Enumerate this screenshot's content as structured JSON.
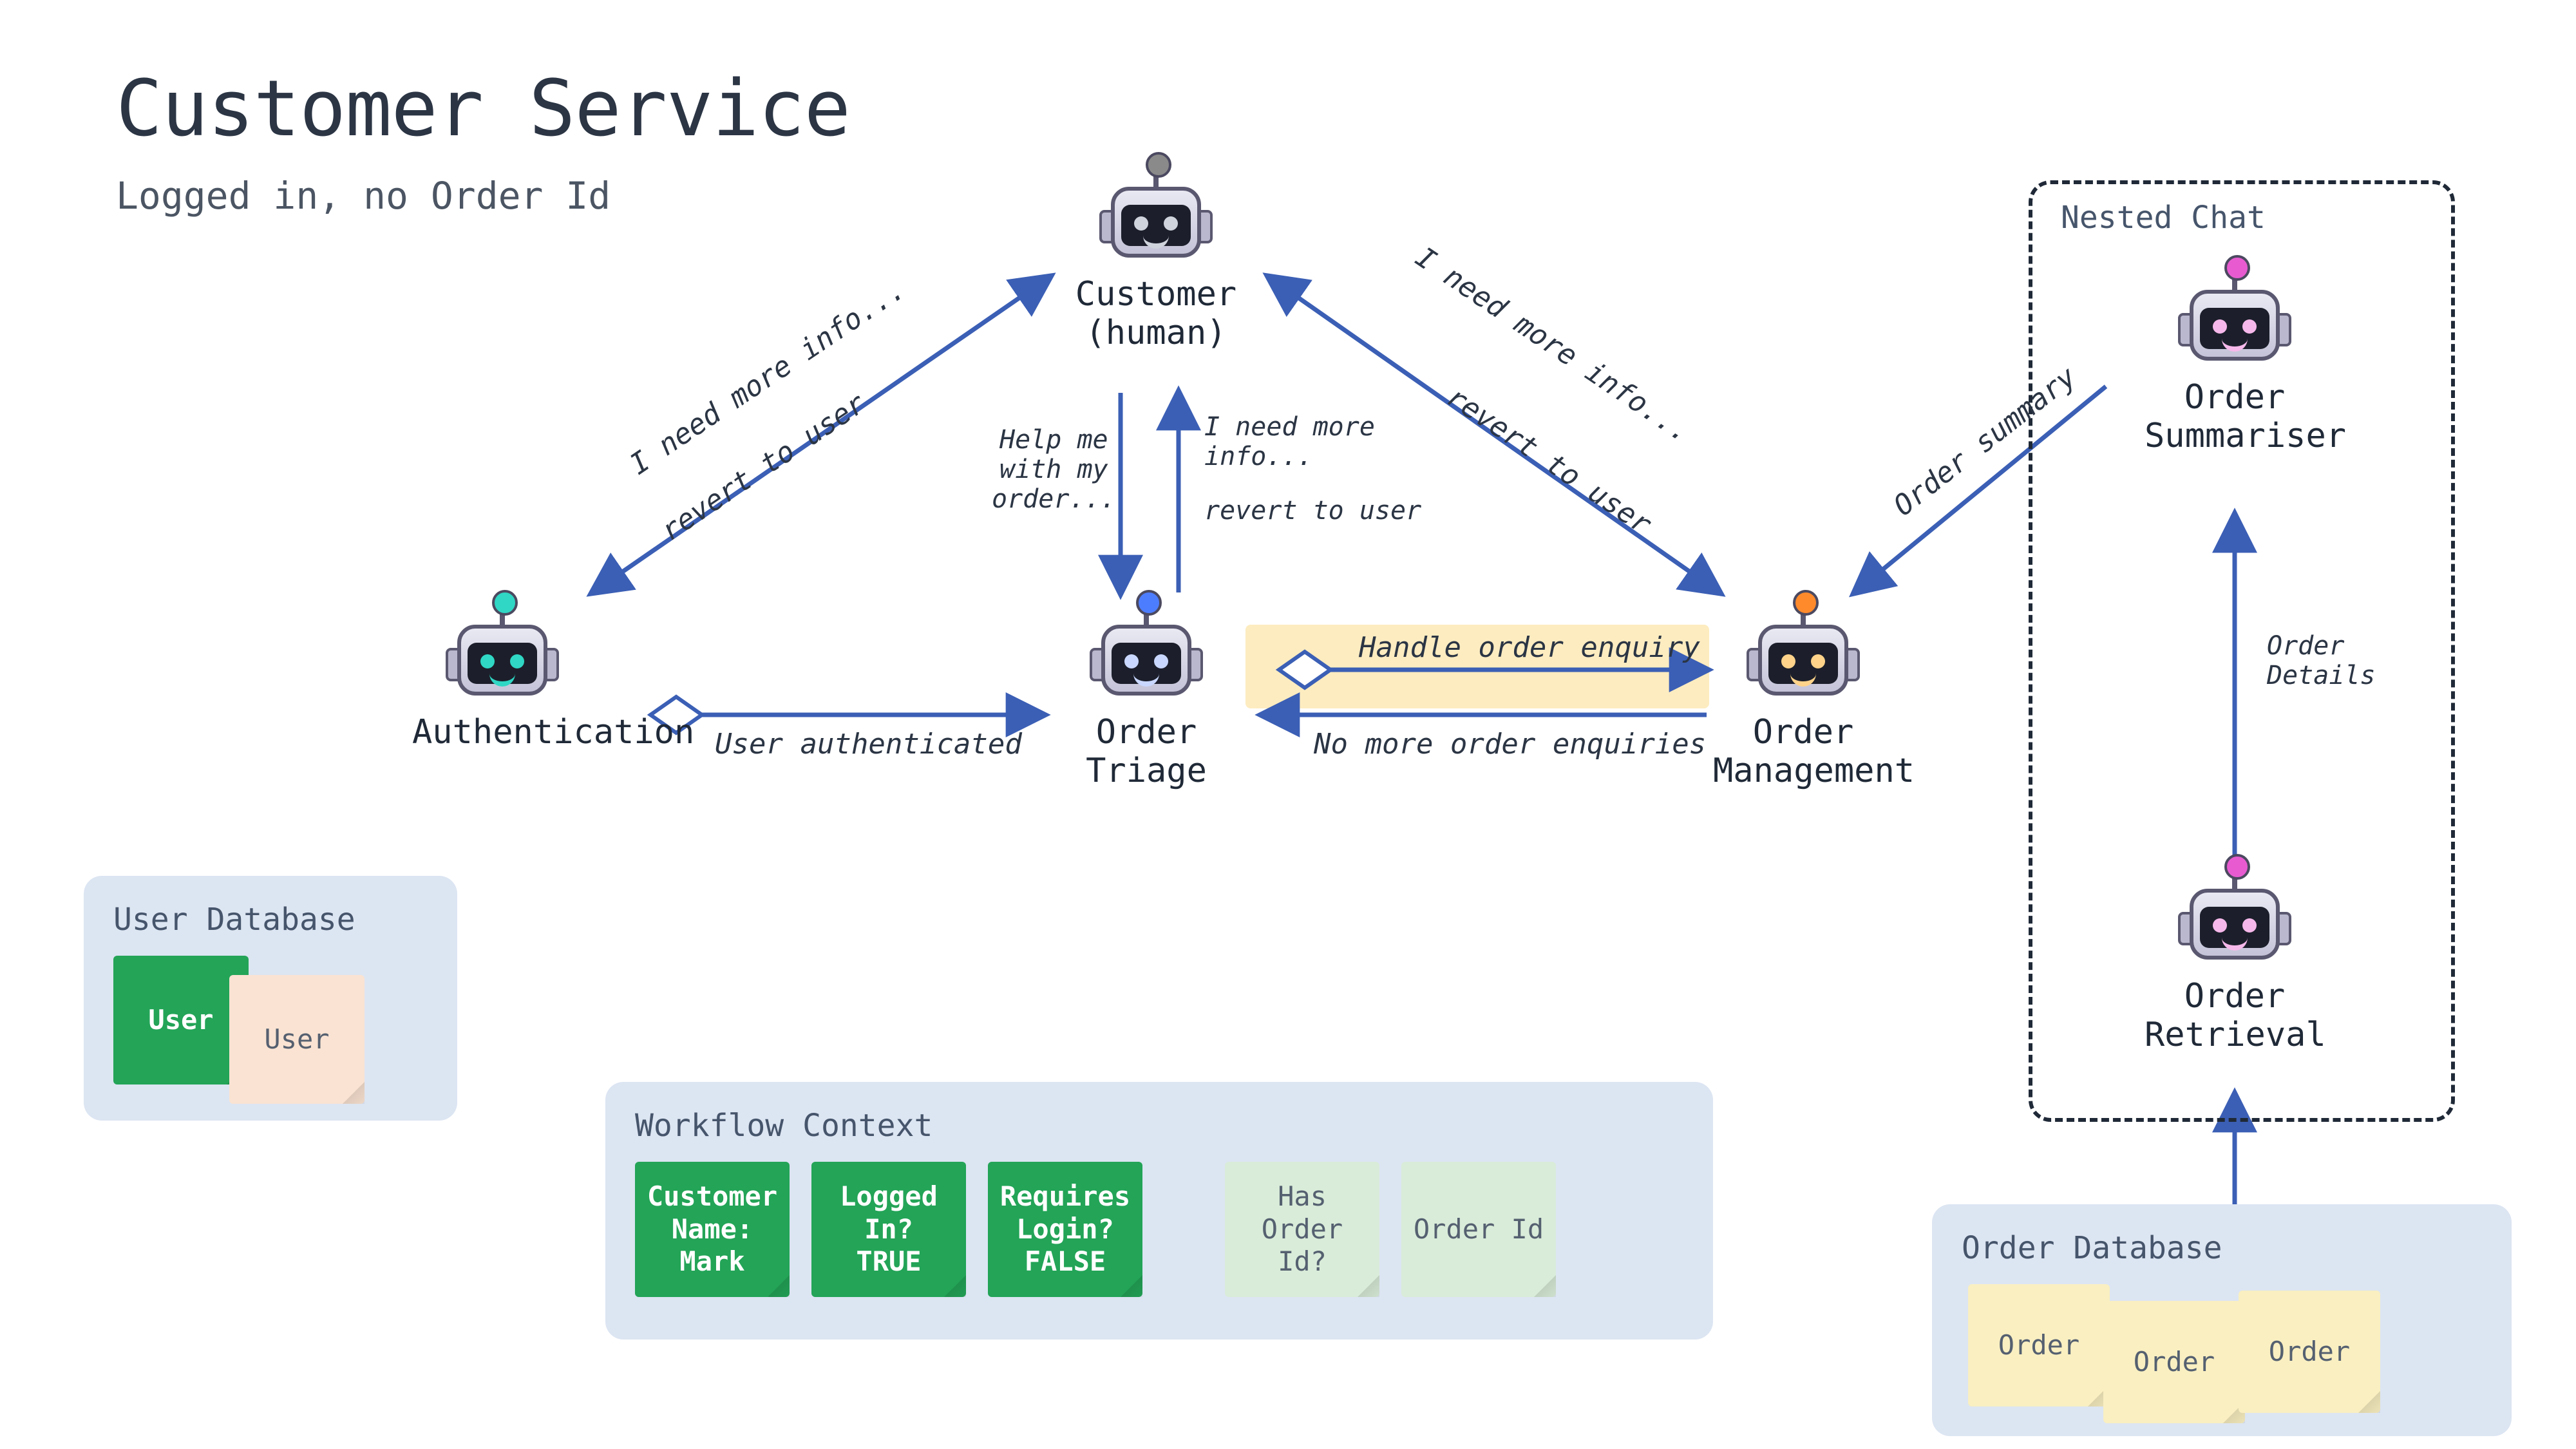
{
  "title": "Customer Service",
  "subtitle": "Logged in, no Order Id",
  "agents": {
    "customer": "Customer\n(human)",
    "authentication": "Authentication",
    "order_triage": "Order\nTriage",
    "order_management": "Order\nManagement",
    "order_summariser": "Order\nSummariser",
    "order_retrieval": "Order\nRetrieval"
  },
  "panels": {
    "nested_chat": "Nested Chat",
    "user_db": "User Database",
    "workflow": "Workflow Context",
    "order_db": "Order Database"
  },
  "edges": {
    "auth_to_cust_top": "I need more info...",
    "auth_to_cust_bot": "revert to user",
    "mgmt_to_cust_top": "I need more info...",
    "mgmt_to_cust_bot": "revert to user",
    "cust_to_triage_left": "Help me\nwith my\norder...",
    "triage_to_cust_right_top": "I need more\ninfo...",
    "triage_to_cust_right_bot": "revert to user",
    "auth_to_triage": "User authenticated",
    "triage_to_mgmt_top": "Handle order enquiry",
    "mgmt_to_triage_bot": "No more order enquiries",
    "mgmt_to_summ": "Order summary",
    "retr_to_summ": "Order\nDetails"
  },
  "user_db_notes": [
    "User",
    "User"
  ],
  "workflow_notes": [
    {
      "text": "Customer\nName:\nMark",
      "kind": "green"
    },
    {
      "text": "Logged\nIn?\nTRUE",
      "kind": "green"
    },
    {
      "text": "Requires\nLogin?\nFALSE",
      "kind": "green"
    },
    {
      "text": "Has\nOrder\nId?",
      "kind": "mint"
    },
    {
      "text": "Order Id",
      "kind": "mint"
    }
  ],
  "order_db_notes": [
    "Order",
    "Order",
    "Order"
  ],
  "agent_colors": {
    "customer": "#8a8a8a",
    "authentication": "#2fd7c4",
    "order_triage": "#4d7dff",
    "order_management": "#ff8a2b",
    "order_summariser": "#e85bd0",
    "order_retrieval": "#e85bd0"
  }
}
